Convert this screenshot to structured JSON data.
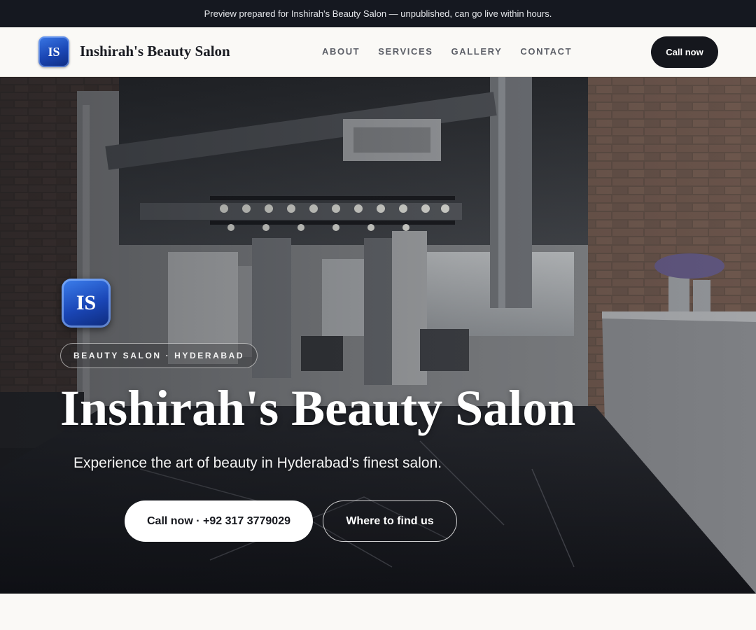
{
  "preview_bar": {
    "text": "Preview prepared for Inshirah's Beauty Salon — unpublished, can go live within hours."
  },
  "header": {
    "logo_initials": "IS",
    "brand_name": "Inshirah's Beauty Salon",
    "nav": [
      {
        "label": "ABOUT"
      },
      {
        "label": "SERVICES"
      },
      {
        "label": "GALLERY"
      },
      {
        "label": "CONTACT"
      }
    ],
    "cta_label": "Call now"
  },
  "hero": {
    "badge_initials": "IS",
    "tagline": "BEAUTY SALON · HYDERABAD",
    "title": "Inshirah's Beauty Salon",
    "subtitle": "Experience the art of beauty in Hyderabad’s finest salon.",
    "primary_button": "Call now · +92 317 3779029",
    "secondary_button": "Where to find us"
  },
  "colors": {
    "dark": "#15171d",
    "page_bg": "#faf9f6",
    "brand_blue": "#1a46b4"
  }
}
